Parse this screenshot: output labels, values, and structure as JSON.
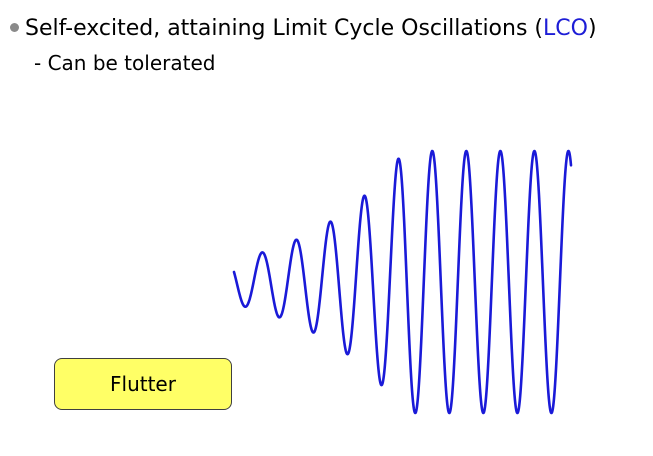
{
  "header": {
    "text_before": "Self-excited, attaining Limit Cycle Oscillations (",
    "acronym": "LCO",
    "text_after": ")"
  },
  "subpoint": "- Can be tolerated",
  "box_label": "Flutter",
  "colors": {
    "accent": "#1d1dd6",
    "wave": "#1a1ad8",
    "box_fill": "#ffff66",
    "bullet": "#8a8a8a"
  },
  "wave": {
    "description_free": true,
    "growth_cycles": 5,
    "saturated_cycles": 5
  }
}
